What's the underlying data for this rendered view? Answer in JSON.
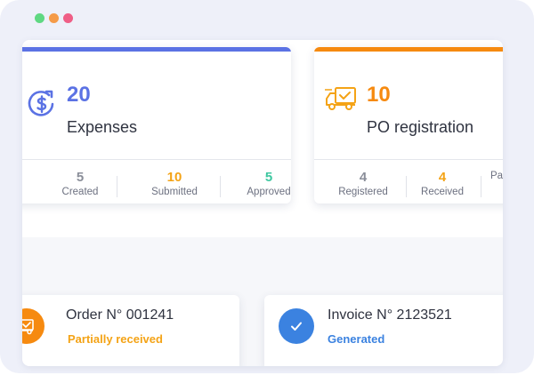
{
  "window_controls": {
    "colors": [
      "#5fd882",
      "#f59b48",
      "#ef5e86"
    ]
  },
  "expenses_card": {
    "count": "20",
    "title": "Expenses",
    "accent": "#5b72e4",
    "icon": "dollar-refresh-icon",
    "stats": [
      {
        "value": "5",
        "label": "Created",
        "color": "#8a8e99"
      },
      {
        "value": "10",
        "label": "Submitted",
        "color": "#f4a316"
      },
      {
        "value": "5",
        "label": "Approved",
        "color": "#3ec7a0"
      }
    ]
  },
  "po_card": {
    "count": "10",
    "title": "PO registration",
    "accent": "#f68a10",
    "icon": "delivery-truck-icon",
    "stats": [
      {
        "value": "4",
        "label": "Registered",
        "color": "#8a8e99"
      },
      {
        "value": "4",
        "label": "Received",
        "color": "#f4a316"
      },
      {
        "value": "",
        "label": "Pa",
        "color": "#8a8e99"
      }
    ]
  },
  "order_card": {
    "title": "Order N° 001241",
    "status": "Partially received",
    "status_color": "#f4a316",
    "icon": "truck-icon"
  },
  "invoice_card": {
    "title": "Invoice N° 2123521",
    "status": "Generated",
    "status_color": "#3b82e0",
    "icon": "check-icon"
  }
}
